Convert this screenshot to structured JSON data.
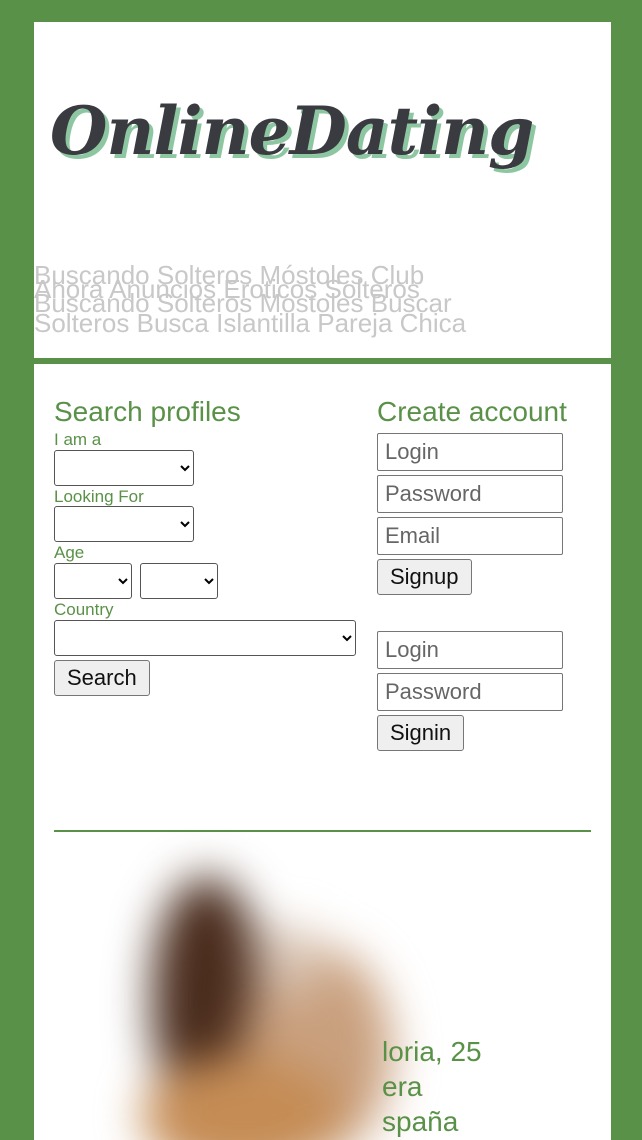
{
  "header": {
    "logo": "OnlineDating",
    "tagline_lines": [
      "Buscando Solteros Móstoles Club",
      "Ahora Anuncios Eroticos Solteros",
      "Buscando Solteros Mostoles Buscar",
      "Solteros Busca Islantilla Pareja Chica"
    ]
  },
  "search": {
    "heading": "Search profiles",
    "i_am_label": "I am a",
    "looking_for_label": "Looking For",
    "age_label": "Age",
    "country_label": "Country",
    "search_button": "Search"
  },
  "signup": {
    "heading": "Create account",
    "login_placeholder": "Login",
    "password_placeholder": "Password",
    "email_placeholder": "Email",
    "signup_button": "Signup"
  },
  "signin": {
    "login_placeholder": "Login",
    "password_placeholder": "Password",
    "signin_button": "Signin"
  },
  "profile": {
    "caption_lines": [
      "loria, 25",
      "era",
      "spaña"
    ]
  },
  "colors": {
    "accent": "#5a9148",
    "logo_text": "#3a3b40",
    "logo_shadow": "#8dc7a2",
    "tagline": "#c8c8c8"
  }
}
